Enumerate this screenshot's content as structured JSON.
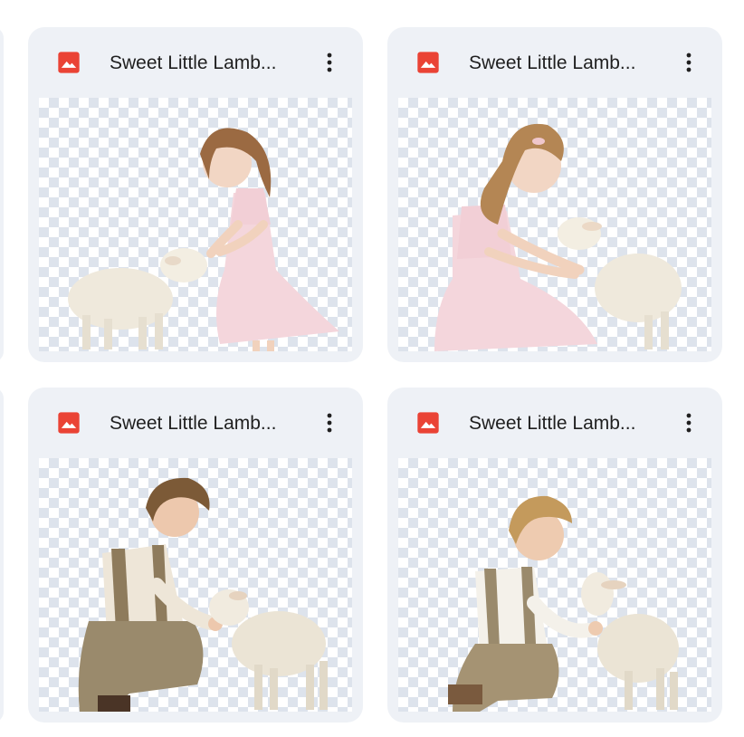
{
  "files": [
    {
      "name": "Sweet Little Lamb...",
      "file_type_icon": "image-icon",
      "subject": "girl-with-lamb-standing"
    },
    {
      "name": "Sweet Little Lamb...",
      "file_type_icon": "image-icon",
      "subject": "girl-with-lamb-kneeling"
    },
    {
      "name": "Sweet Little Lamb...",
      "file_type_icon": "image-icon",
      "subject": "boy-with-lamb-feeding"
    },
    {
      "name": "Sweet Little Lamb...",
      "file_type_icon": "image-icon",
      "subject": "boy-with-lamb-petting"
    }
  ],
  "colors": {
    "card_background": "#eef1f6",
    "image_icon": "#ea4335",
    "text": "#1f1f1f",
    "checker": "#dde3ec"
  }
}
